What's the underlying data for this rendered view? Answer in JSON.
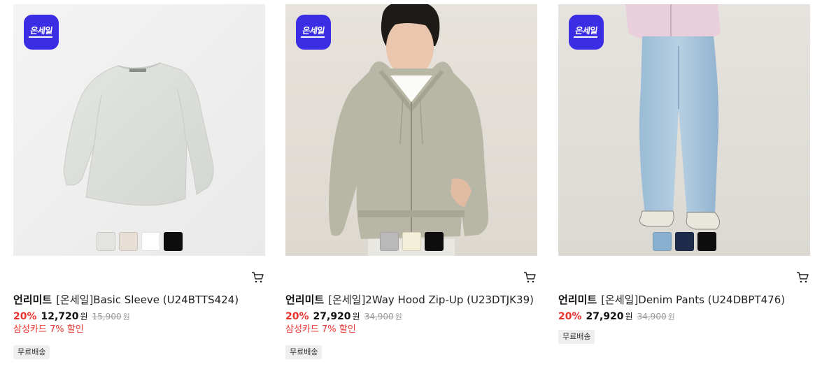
{
  "products": [
    {
      "badge": "온세일",
      "brand": "언리미트",
      "name": "[온세일]Basic Sleeve (U24BTTS424)",
      "discount": "20%",
      "sale_price": "12,720",
      "currency": "원",
      "original_price": "15,900",
      "original_currency": "원",
      "card_promo": "삼성카드 7% 할인",
      "tag": "무료배송",
      "image_bg": "#eeeeee",
      "swatches": [
        "#e3e3df",
        "#e7dfd5",
        "#ffffff",
        "#0d0d0d"
      ],
      "cart_icon": "cart-icon"
    },
    {
      "badge": "온세일",
      "brand": "언리미트",
      "name": "[온세일]2Way Hood Zip-Up (U23DTJK39)",
      "discount": "20%",
      "sale_price": "27,920",
      "currency": "원",
      "original_price": "34,900",
      "original_currency": "원",
      "card_promo": "삼성카드 7% 할인",
      "tag": "무료배송",
      "image_bg": "#e6e3dc",
      "swatches": [
        "#b9b9b9",
        "#f3efd9",
        "#0d0d0d"
      ],
      "cart_icon": "cart-icon"
    },
    {
      "badge": "온세일",
      "brand": "언리미트",
      "name": "[온세일]Denim Pants (U24DBPT476)",
      "discount": "20%",
      "sale_price": "27,920",
      "currency": "원",
      "original_price": "34,900",
      "original_currency": "원",
      "card_promo": "",
      "tag": "무료배송",
      "image_bg": "#e4e1dc",
      "swatches": [
        "#8ab0cf",
        "#1d2c4b",
        "#0d0d0d"
      ],
      "cart_icon": "cart-icon"
    }
  ],
  "colors": {
    "badge": "#3b2de3",
    "discount": "#e8332d",
    "promo": "#e8332d"
  }
}
